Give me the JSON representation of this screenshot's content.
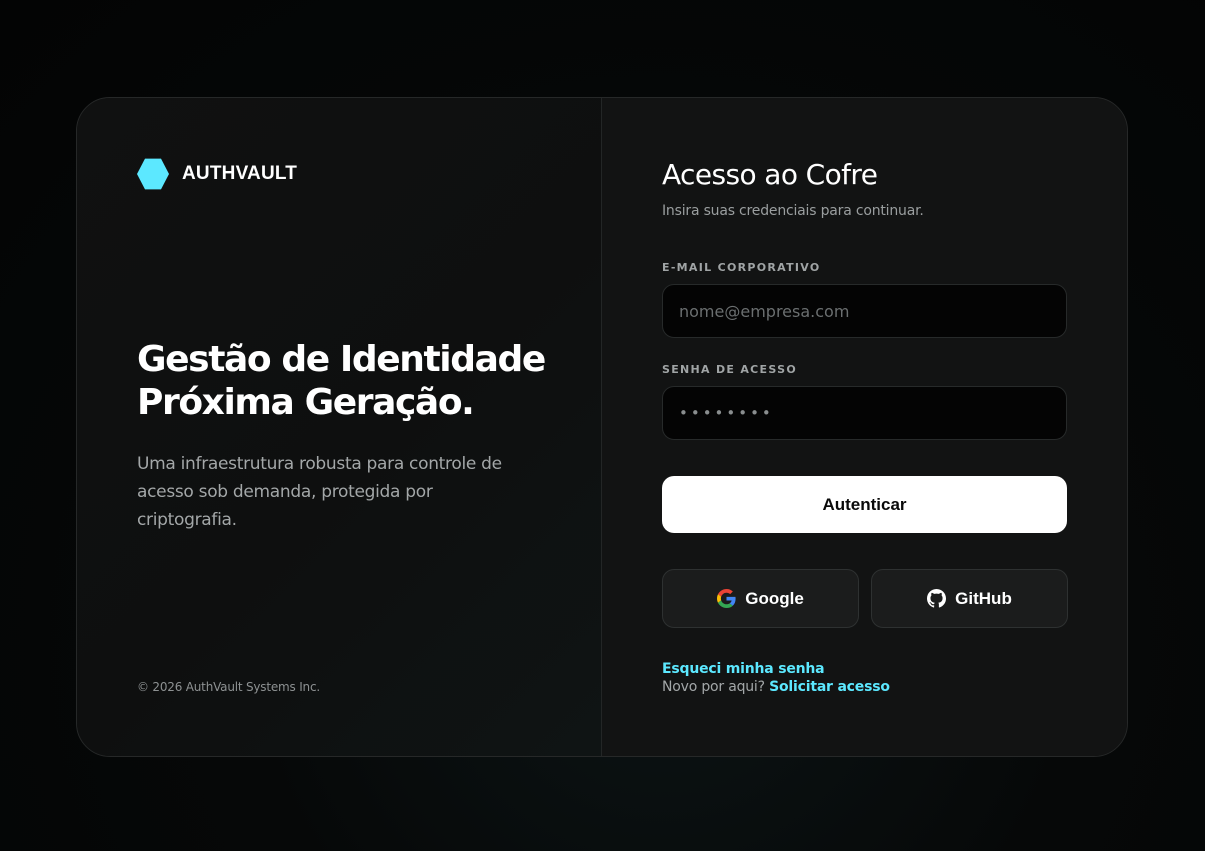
{
  "brand": {
    "name": "AUTHVAULT",
    "logo_color": "#5ce8ff"
  },
  "hero": {
    "title_line1": "Gestão de Identidade",
    "title_line2": "Próxima Geração.",
    "description": "Uma infraestrutura robusta para controle de acesso sob demanda, protegida por criptografia."
  },
  "footer": {
    "copyright": "© 2026 AuthVault Systems Inc."
  },
  "form": {
    "title": "Acesso ao Cofre",
    "subtitle": "Insira suas credenciais para continuar.",
    "email_label": "E-MAIL CORPORATIVO",
    "email_placeholder": "nome@empresa.com",
    "password_label": "SENHA DE ACESSO",
    "password_placeholder": "••••••••",
    "submit_label": "Autenticar",
    "google_label": "Google",
    "github_label": "GitHub",
    "forgot_label": "Esqueci minha senha",
    "new_user_text": "Novo por aqui?",
    "request_access_label": "Solicitar acesso"
  },
  "icons": {
    "google": "google-icon",
    "github": "github-icon",
    "logo": "hexagon-logo-icon"
  },
  "colors": {
    "accent": "#5ce8ff",
    "background": "#050606",
    "card": "#111212"
  }
}
